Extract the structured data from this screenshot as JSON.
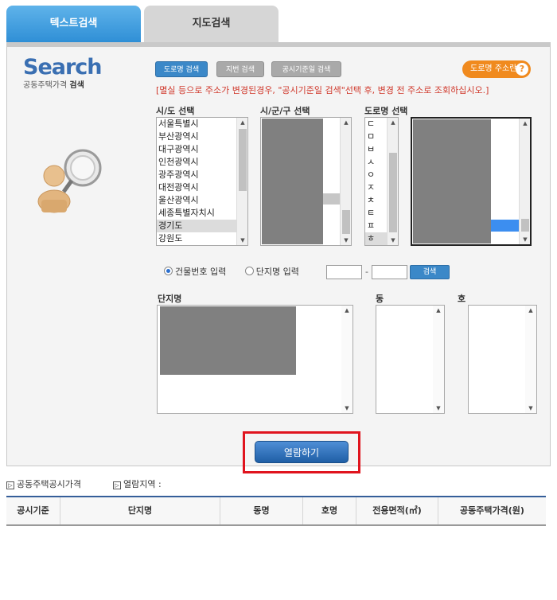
{
  "tabs": [
    {
      "label": "텍스트검색"
    },
    {
      "label": "지도검색"
    }
  ],
  "logo": {
    "word": "Search",
    "sub_plain": "공동주택가격",
    "sub_bold": "검색"
  },
  "mode_buttons": {
    "road": "도로명 검색",
    "jibun": "지번 검색",
    "date": "공시기준일 검색"
  },
  "help_button": {
    "label": "도로명 주소란",
    "icon": "?"
  },
  "notice": "[멸실 등으로 주소가 변경된경우, \"공시기준일 검색\"선택 후, 변경 전 주소로 조회하십시오.]",
  "sido": {
    "label": "시/도 선택",
    "items": [
      "서울특별시",
      "부산광역시",
      "대구광역시",
      "인천광역시",
      "광주광역시",
      "대전광역시",
      "울산광역시",
      "세종특별자치시",
      "경기도",
      "강원도"
    ],
    "selected_index": 8
  },
  "sigungu": {
    "label": "시/군/구 선택"
  },
  "road": {
    "label": "도로명 선택",
    "initials": [
      "ㄷ",
      "ㅁ",
      "ㅂ",
      "ㅅ",
      "ㅇ",
      "ㅈ",
      "ㅊ",
      "ㅌ",
      "ㅍ",
      "ㅎ"
    ],
    "selected_index": 9
  },
  "radio": {
    "building": "건물번호 입력",
    "complex": "단지명 입력",
    "selected": "building"
  },
  "search_button": "검색",
  "dash": "-",
  "complex_list": {
    "label": "단지명"
  },
  "dong_list": {
    "label": "동"
  },
  "ho_list": {
    "label": "호"
  },
  "open_button": "열람하기",
  "info": {
    "price": "공동주택공시가격",
    "region": "열람지역 :"
  },
  "table": {
    "headers": [
      "공시기준",
      "단지명",
      "동명",
      "호명",
      "전용면적(㎡)",
      "공동주택가격(원)"
    ]
  },
  "colors": {
    "accent": "#3b88c8",
    "help": "#f08a1e",
    "notice": "#d0382b",
    "highlight_border": "#e0141e"
  }
}
